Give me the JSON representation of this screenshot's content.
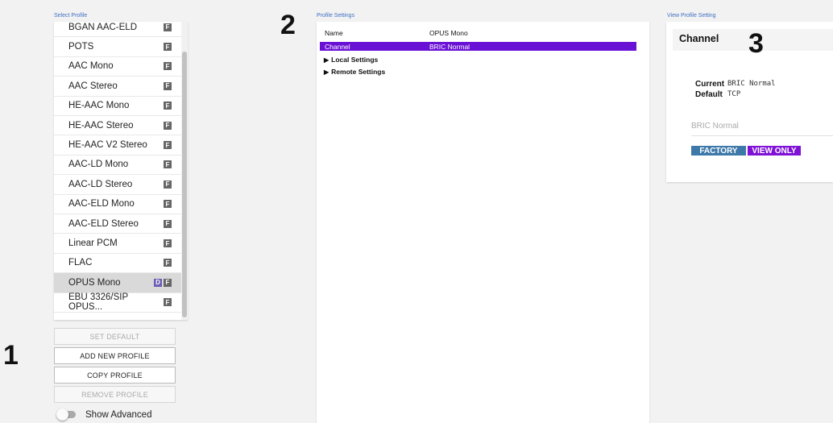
{
  "select_profile": {
    "title": "Select Profile",
    "items": [
      {
        "label": "BGAN AAC-ELD",
        "badges": [
          "F"
        ],
        "selected": false
      },
      {
        "label": "POTS",
        "badges": [
          "F"
        ],
        "selected": false
      },
      {
        "label": "AAC Mono",
        "badges": [
          "F"
        ],
        "selected": false
      },
      {
        "label": "AAC Stereo",
        "badges": [
          "F"
        ],
        "selected": false
      },
      {
        "label": "HE-AAC Mono",
        "badges": [
          "F"
        ],
        "selected": false
      },
      {
        "label": "HE-AAC Stereo",
        "badges": [
          "F"
        ],
        "selected": false
      },
      {
        "label": "HE-AAC V2 Stereo",
        "badges": [
          "F"
        ],
        "selected": false
      },
      {
        "label": "AAC-LD Mono",
        "badges": [
          "F"
        ],
        "selected": false
      },
      {
        "label": "AAC-LD Stereo",
        "badges": [
          "F"
        ],
        "selected": false
      },
      {
        "label": "AAC-ELD Mono",
        "badges": [
          "F"
        ],
        "selected": false
      },
      {
        "label": "AAC-ELD Stereo",
        "badges": [
          "F"
        ],
        "selected": false
      },
      {
        "label": "Linear PCM",
        "badges": [
          "F"
        ],
        "selected": false
      },
      {
        "label": "FLAC",
        "badges": [
          "F"
        ],
        "selected": false
      },
      {
        "label": "OPUS Mono",
        "badges": [
          "D",
          "F"
        ],
        "selected": true
      },
      {
        "label": "EBU 3326/SIP OPUS...",
        "badges": [
          "F"
        ],
        "selected": false
      }
    ],
    "buttons": {
      "set_default": "SET DEFAULT",
      "add_new": "ADD NEW PROFILE",
      "copy": "COPY PROFILE",
      "remove": "REMOVE PROFILE"
    },
    "show_advanced": {
      "label": "Show Advanced",
      "on": false
    }
  },
  "profile_settings": {
    "title": "Profile Settings",
    "rows": [
      {
        "key": "Name",
        "value": "OPUS Mono",
        "highlighted": false
      },
      {
        "key": "Channel",
        "value": "BRIC Normal",
        "highlighted": true
      }
    ],
    "tree": [
      "Local Settings",
      "Remote Settings"
    ]
  },
  "view_profile_setting": {
    "title": "View Profile Setting",
    "header": "Channel",
    "current_label": "Current",
    "current_value": "BRIC Normal",
    "default_label": "Default",
    "default_value": "TCP",
    "input_value": "BRIC Normal",
    "tags": [
      "FACTORY",
      "VIEW ONLY"
    ]
  },
  "callouts": [
    "1",
    "2",
    "3"
  ],
  "colors": {
    "accent_purple": "#6a11d6",
    "factory_blue": "#3d78a9",
    "view_only_purple": "#7f12d6",
    "panel_title_blue": "#3f6fc4"
  }
}
